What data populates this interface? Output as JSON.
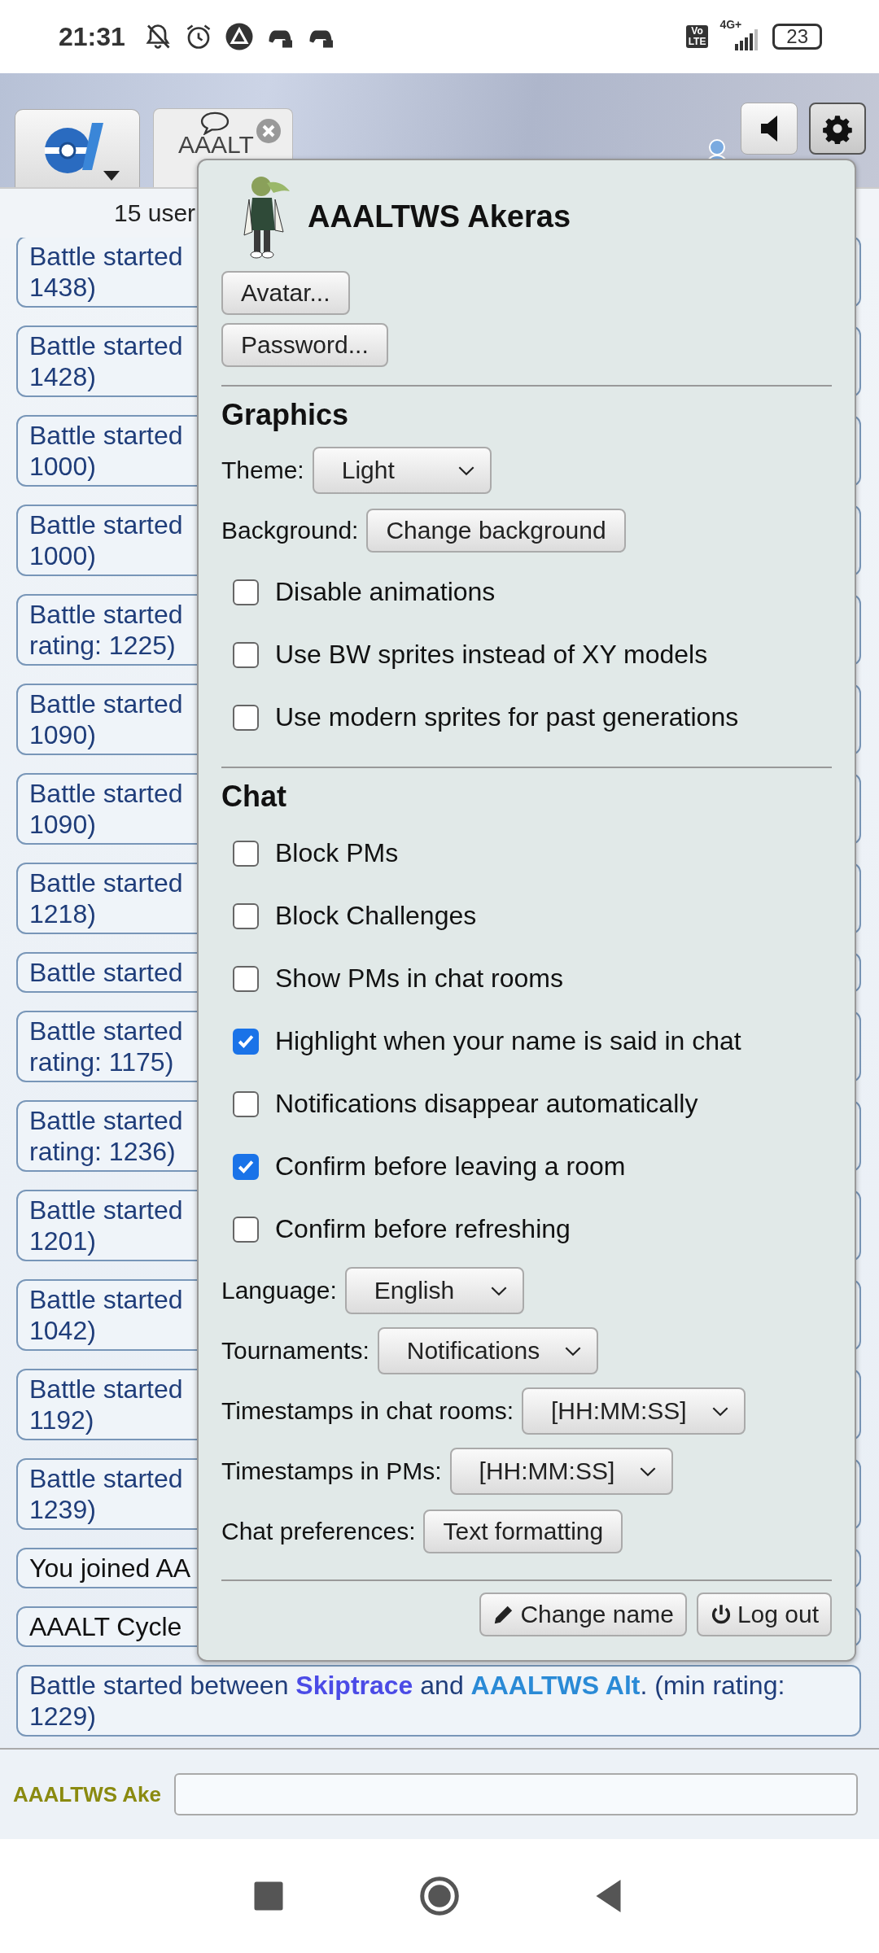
{
  "status_bar": {
    "time": "21:31",
    "volte": [
      "Vo",
      "LTE"
    ],
    "network": "4G+",
    "battery": "23"
  },
  "header": {
    "room_tab": {
      "label": "AAALT"
    },
    "settings_button": {
      "selected": true
    }
  },
  "users_bar": {
    "count": "15 user"
  },
  "messages": [
    {
      "kind": "battle",
      "text": "Battle started\n1438)"
    },
    {
      "kind": "battle",
      "text": "Battle started\n1428)"
    },
    {
      "kind": "battle",
      "text": "Battle started\n1000)"
    },
    {
      "kind": "battle",
      "text": "Battle started\n1000)"
    },
    {
      "kind": "battle",
      "text": "Battle started\nrating: 1225)"
    },
    {
      "kind": "battle",
      "text": "Battle started\n1090)"
    },
    {
      "kind": "battle",
      "text": "Battle started\n1090)"
    },
    {
      "kind": "battle",
      "text": "Battle started\n1218)"
    },
    {
      "kind": "battle",
      "text": "Battle started"
    },
    {
      "kind": "battle",
      "text": "Battle started\nrating: 1175)"
    },
    {
      "kind": "battle",
      "text": "Battle started\nrating: 1236)"
    },
    {
      "kind": "battle",
      "text": "Battle started\n1201)"
    },
    {
      "kind": "battle",
      "text": "Battle started\n1042)"
    },
    {
      "kind": "battle",
      "text": "Battle started\n1192)"
    },
    {
      "kind": "battle",
      "text": "Battle started\n1239)"
    },
    {
      "kind": "notice",
      "text": "You joined AA"
    },
    {
      "kind": "notice",
      "text": "AAALT Cycle"
    },
    {
      "kind": "battle_parts",
      "parts": [
        {
          "text": "Battle started between "
        },
        {
          "text": "Skiptrace",
          "color": "#4b4be6"
        },
        {
          "text": " and "
        },
        {
          "text": "AAALTWS Alt",
          "color": "#2a8ad6"
        },
        {
          "text": ". (min rating: 1229)"
        }
      ]
    }
  ],
  "chat_input": {
    "username": "AAALTWS Ake"
  },
  "popup": {
    "username": "AAALTWS Akeras",
    "account_buttons": [
      "Avatar...",
      "Password..."
    ],
    "sections": [
      {
        "title": "Graphics",
        "rows": [
          {
            "kind": "select",
            "label": "Theme:",
            "value": "Light"
          },
          {
            "kind": "button",
            "label": "Background:",
            "value": "Change background"
          },
          {
            "kind": "checkbox",
            "label": "Disable animations",
            "checked": false
          },
          {
            "kind": "checkbox",
            "label": "Use BW sprites instead of XY models",
            "checked": false
          },
          {
            "kind": "checkbox",
            "label": "Use modern sprites for past generations",
            "checked": false
          }
        ]
      },
      {
        "title": "Chat",
        "rows": [
          {
            "kind": "checkbox",
            "label": "Block PMs",
            "checked": false
          },
          {
            "kind": "checkbox",
            "label": "Block Challenges",
            "checked": false
          },
          {
            "kind": "checkbox",
            "label": "Show PMs in chat rooms",
            "checked": false
          },
          {
            "kind": "checkbox",
            "label": "Highlight when your name is said in chat",
            "checked": true
          },
          {
            "kind": "checkbox",
            "label": "Notifications disappear automatically",
            "checked": false
          },
          {
            "kind": "checkbox",
            "label": "Confirm before leaving a room",
            "checked": true
          },
          {
            "kind": "checkbox",
            "label": "Confirm before refreshing",
            "checked": false
          },
          {
            "kind": "select",
            "label": "Language:",
            "value": "English"
          },
          {
            "kind": "select",
            "label": "Tournaments:",
            "value": "Notifications"
          },
          {
            "kind": "select",
            "label": "Timestamps in chat rooms:",
            "value": "[HH:MM:SS]"
          },
          {
            "kind": "select",
            "label": "Timestamps in PMs:",
            "value": "[HH:MM:SS]"
          },
          {
            "kind": "button",
            "label": "Chat preferences:",
            "value": "Text formatting"
          }
        ]
      }
    ],
    "footer_buttons": [
      {
        "kind": "rename",
        "label": "Change name"
      },
      {
        "kind": "logout",
        "label": "Log out"
      }
    ]
  }
}
